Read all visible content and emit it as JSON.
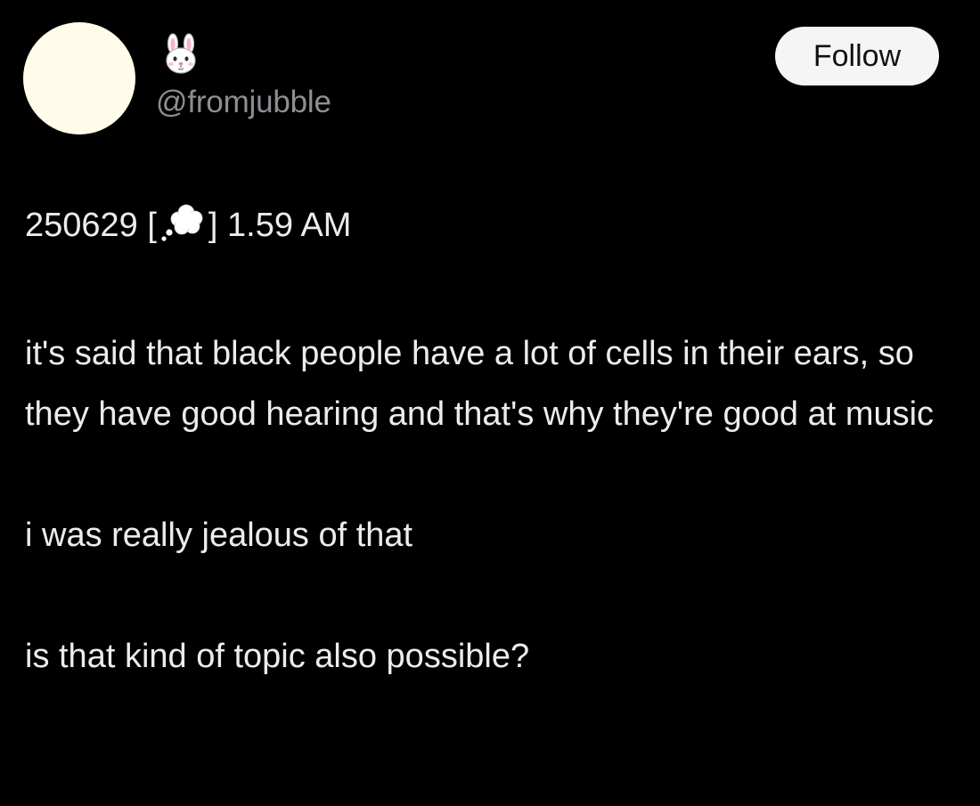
{
  "post": {
    "author": {
      "avatar_color": "#fffdea",
      "display_name_icon": "rabbit-face-icon",
      "handle": "@fromjubble"
    },
    "follow_label": "Follow",
    "dateline": {
      "date": "250629 [",
      "icon": "thought-balloon-icon",
      "time": "] 1.59 AM"
    },
    "paragraphs": [
      "it's said that black people have a lot of cells in their ears, so they have good hearing and that's why they're good at music",
      "i was really jealous of that",
      "is that kind of topic also possible?"
    ]
  },
  "colors": {
    "background": "#000000",
    "text": "#ececec",
    "handle": "#8e8e93",
    "button_bg": "#f5f5f5",
    "button_text": "#111111"
  }
}
